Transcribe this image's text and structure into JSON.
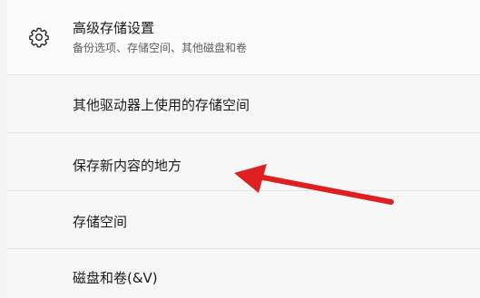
{
  "advanced_storage": {
    "title": "高级存储设置",
    "subtitle": "备份选项、存储空间、其他磁盘和卷",
    "icon": "gear-icon"
  },
  "items": [
    {
      "label": "其他驱动器上使用的存储空间"
    },
    {
      "label": "保存新内容的地方"
    },
    {
      "label": "存储空间"
    },
    {
      "label": "磁盘和卷(&V)"
    }
  ],
  "annotation": {
    "arrow_color": "#e02020",
    "points_to": "保存新内容的地方"
  }
}
